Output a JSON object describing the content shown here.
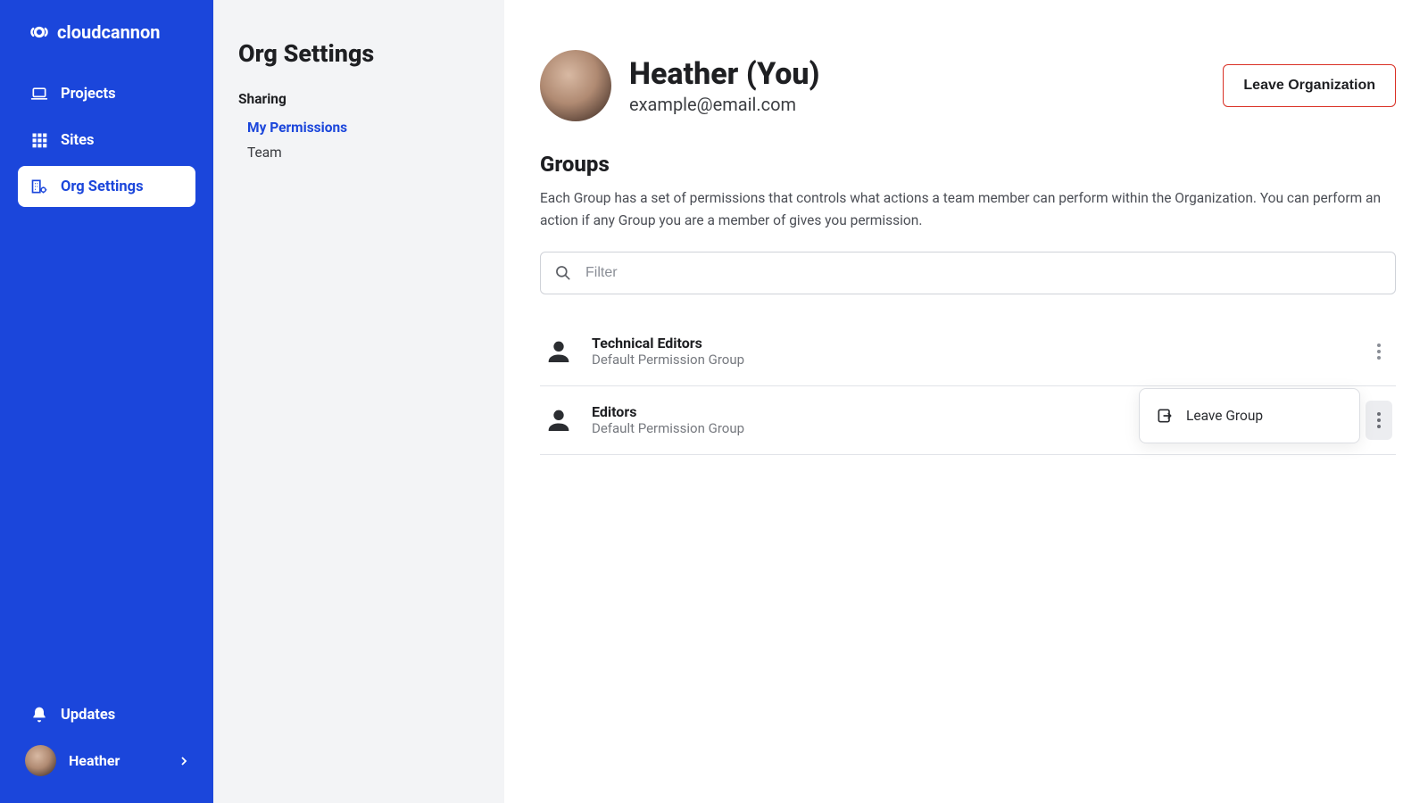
{
  "brand": "cloudcannon",
  "sidebar": {
    "items": [
      {
        "label": "Projects"
      },
      {
        "label": "Sites"
      },
      {
        "label": "Org Settings"
      }
    ],
    "updates_label": "Updates",
    "user_name": "Heather"
  },
  "panel": {
    "title": "Org Settings",
    "section": "Sharing",
    "links": [
      {
        "label": "My Permissions"
      },
      {
        "label": "Team"
      }
    ]
  },
  "profile": {
    "name": "Heather (You)",
    "email": "example@email.com",
    "leave_org_label": "Leave Organization"
  },
  "groups_section": {
    "title": "Groups",
    "description": "Each Group has a set of permissions that controls what actions a team member can perform within the Organization. You can perform an action if any Group you are a member of gives you permission.",
    "filter_placeholder": "Filter"
  },
  "groups": [
    {
      "name": "Technical Editors",
      "subtitle": "Default Permission Group"
    },
    {
      "name": "Editors",
      "subtitle": "Default Permission Group"
    }
  ],
  "popover": {
    "leave_group_label": "Leave Group"
  }
}
